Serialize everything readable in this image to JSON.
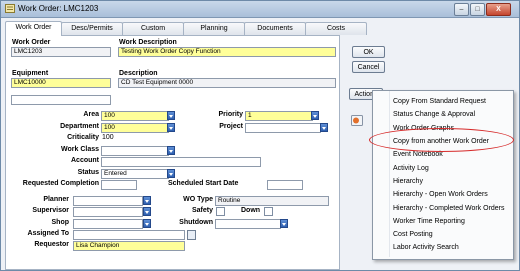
{
  "window": {
    "title": "Work Order: LMC1203",
    "min": "–",
    "max": "□",
    "close": "X"
  },
  "tabs": [
    "Work Order",
    "Desc/Permits",
    "Custom",
    "Planning",
    "Documents",
    "Costs"
  ],
  "fields": {
    "work_order": {
      "label": "Work Order",
      "value": "LMC1203"
    },
    "work_description": {
      "label": "Work Description",
      "value": "Testing Work Order Copy Function"
    },
    "equipment": {
      "label": "Equipment",
      "value": "LMC10000"
    },
    "description": {
      "label": "Description",
      "value": "CD Test Equipment 0000"
    },
    "area": {
      "label": "Area",
      "value": "100"
    },
    "department": {
      "label": "Department",
      "value": "100"
    },
    "criticality": {
      "label": "Criticality",
      "value": "100"
    },
    "work_class": {
      "label": "Work Class",
      "value": ""
    },
    "account": {
      "label": "Account",
      "value": ""
    },
    "status": {
      "label": "Status",
      "value": "Entered"
    },
    "requested_completion": {
      "label": "Requested Completion",
      "value": ""
    },
    "planner": {
      "label": "Planner",
      "value": ""
    },
    "supervisor": {
      "label": "Supervisor",
      "value": ""
    },
    "shop": {
      "label": "Shop",
      "value": ""
    },
    "assigned_to": {
      "label": "Assigned To",
      "value": ""
    },
    "requestor": {
      "label": "Requestor",
      "value": "Lisa Champion"
    },
    "priority": {
      "label": "Priority",
      "value": "1"
    },
    "project": {
      "label": "Project",
      "value": ""
    },
    "scheduled_start": {
      "label": "Scheduled Start Date",
      "value": ""
    },
    "wo_type": {
      "label": "WO Type",
      "value": "Routine"
    },
    "safety": {
      "label": "Safety"
    },
    "down": {
      "label": "Down"
    },
    "shutdown": {
      "label": "Shutdown",
      "value": ""
    }
  },
  "buttons": {
    "ok": "OK",
    "cancel": "Cancel",
    "actions": "Actions"
  },
  "actions_menu": [
    "Copy From Standard Request",
    "Status Change & Approval",
    "Work Order Graphs",
    "Copy from another Work Order",
    "Event Notebook",
    "Activity Log",
    "Hierarchy",
    "Hierarchy - Open Work Orders",
    "Hierarchy - Completed Work Orders",
    "Worker Time Reporting",
    "Cost Posting",
    "Labor Activity Search"
  ],
  "colors": {
    "required_field": "#ffff99",
    "highlight_oval": "#d62a2a",
    "dropdown": "#2d5fb0"
  }
}
